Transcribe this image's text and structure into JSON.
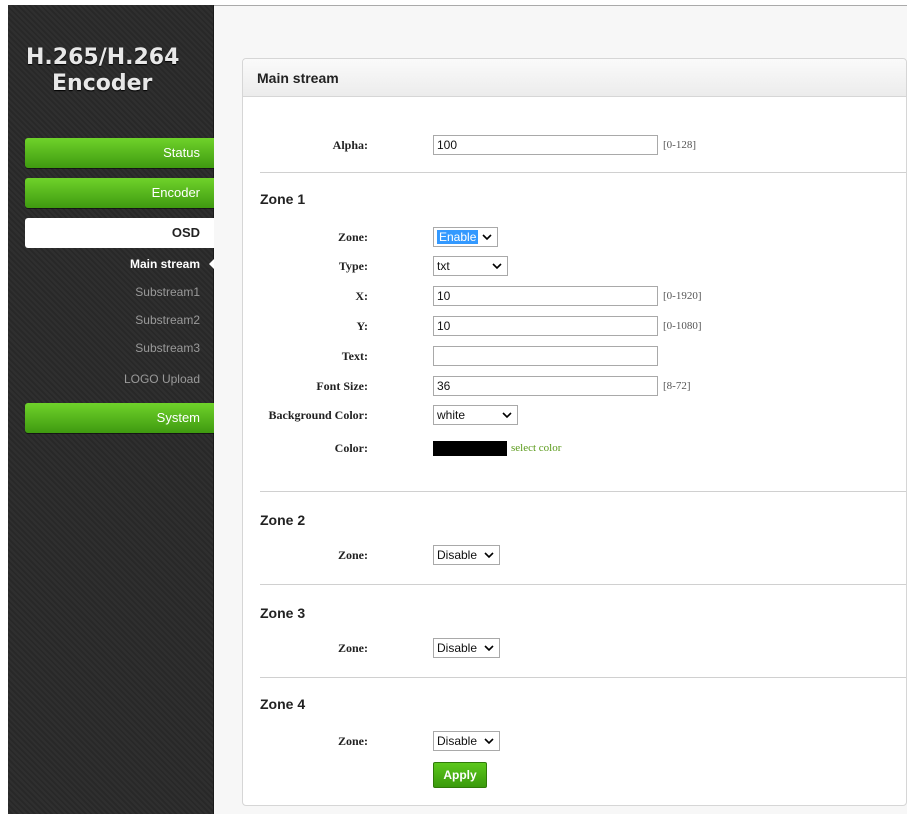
{
  "app": {
    "title_line1": "H.265/H.264",
    "title_line2": "Encoder"
  },
  "sidebar": {
    "status": "Status",
    "encoder": "Encoder",
    "osd": "OSD",
    "sub_items": [
      "Main stream",
      "Substream1",
      "Substream2",
      "Substream3",
      "LOGO Upload"
    ],
    "system": "System"
  },
  "panel": {
    "title": "Main stream",
    "alpha": {
      "label": "Alpha:",
      "value": "100",
      "range": "[0-128]"
    },
    "zone1": {
      "title": "Zone 1",
      "zone_label": "Zone:",
      "zone_value": "Enable",
      "type_label": "Type:",
      "type_value": "txt",
      "x_label": "X:",
      "x_value": "10",
      "x_range": "[0-1920]",
      "y_label": "Y:",
      "y_value": "10",
      "y_range": "[0-1080]",
      "text_label": "Text:",
      "text_value": "",
      "font_label": "Font Size:",
      "font_value": "36",
      "font_range": "[8-72]",
      "bg_label": "Background Color:",
      "bg_value": "white",
      "color_label": "Color:",
      "color_value": "#000000",
      "select_color": "select color"
    },
    "zone2": {
      "title": "Zone 2",
      "zone_label": "Zone:",
      "zone_value": "Disable"
    },
    "zone3": {
      "title": "Zone 3",
      "zone_label": "Zone:",
      "zone_value": "Disable"
    },
    "zone4": {
      "title": "Zone 4",
      "zone_label": "Zone:",
      "zone_value": "Disable"
    },
    "apply": "Apply"
  },
  "colors": {
    "accent_green": "#4caf1a",
    "sidebar_bg": "#2a2a2a",
    "select_highlight": "#3399ff"
  }
}
